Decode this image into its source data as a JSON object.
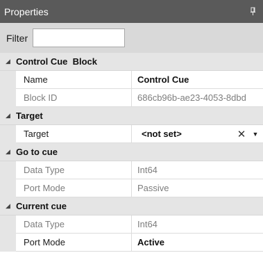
{
  "panel": {
    "title": "Properties",
    "pin_glyph": "ᵖ"
  },
  "filter": {
    "label": "Filter",
    "value": ""
  },
  "categories": [
    {
      "label": "Control Cue  Block",
      "rows": [
        {
          "name": "Name",
          "value": "Control Cue"
        },
        {
          "name": "Block ID",
          "value": "686cb96b-ae23-4053-8dbd"
        }
      ]
    },
    {
      "label": "Target",
      "rows": [
        {
          "name": "Target",
          "value": "<not set>",
          "clear_glyph": "✕",
          "dropdown_glyph": "▼"
        }
      ]
    },
    {
      "label": "Go to cue",
      "rows": [
        {
          "name": "Data Type",
          "value": "Int64"
        },
        {
          "name": "Port Mode",
          "value": "Passive"
        }
      ]
    },
    {
      "label": "Current cue",
      "rows": [
        {
          "name": "Data Type",
          "value": "Int64"
        },
        {
          "name": "Port Mode",
          "value": "Active"
        }
      ]
    }
  ],
  "collapse_glyph": "◢"
}
